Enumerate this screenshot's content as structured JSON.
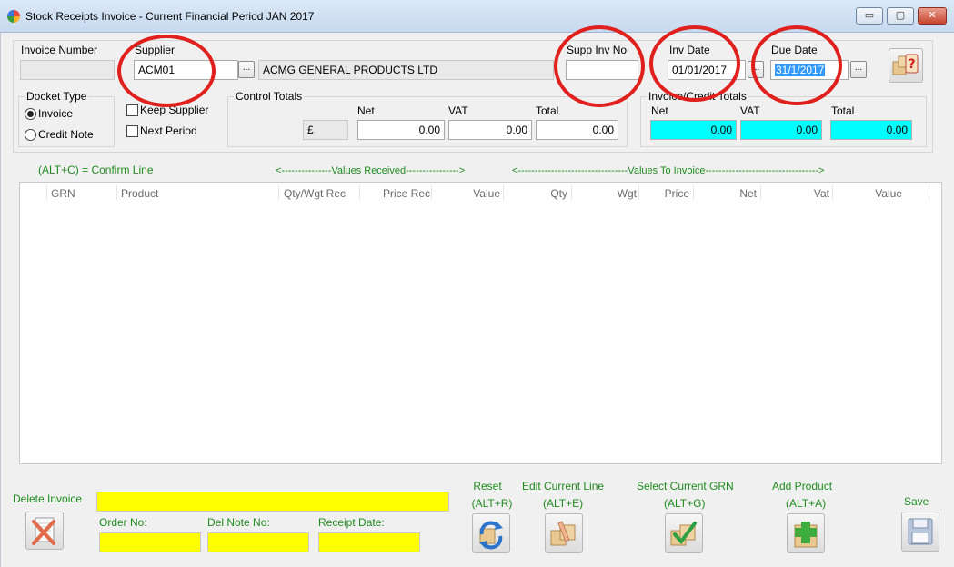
{
  "window": {
    "title": "Stock Receipts Invoice - Current Financial Period JAN 2017",
    "minimize": "▭",
    "maximize": "▢",
    "close": "✕"
  },
  "header": {
    "invoice_number_label": "Invoice Number",
    "invoice_number_value": "",
    "supplier_label": "Supplier",
    "supplier_code": "ACM01",
    "supplier_name": "ACMG GENERAL PRODUCTS LTD",
    "supp_inv_no_label": "Supp Inv No",
    "supp_inv_no_value": "",
    "inv_date_label": "Inv Date",
    "inv_date_value": "01/01/2017",
    "due_date_label": "Due Date",
    "due_date_value": "31/1/2017",
    "ellipsis": "..."
  },
  "docket_type": {
    "label": "Docket Type",
    "options": [
      "Invoice",
      "Credit Note"
    ],
    "selected": "Invoice"
  },
  "options": {
    "keep_supplier": "Keep Supplier",
    "next_period": "Next Period"
  },
  "control_totals": {
    "label": "Control Totals",
    "currency": "£",
    "net_label": "Net",
    "vat_label": "VAT",
    "total_label": "Total",
    "net": "0.00",
    "vat": "0.00",
    "total": "0.00"
  },
  "invoice_totals": {
    "label": "Invoice/Credit Totals",
    "net_label": "Net",
    "vat_label": "VAT",
    "total_label": "Total",
    "net": "0.00",
    "vat": "0.00",
    "total": "0.00"
  },
  "hints": {
    "confirm_line": "(ALT+C) = Confirm Line",
    "values_received": "<---------------Values Received---------------->",
    "values_to_invoice": "<---------------------------------Values To Invoice---------------------------------->"
  },
  "grid": {
    "columns": [
      "GRN",
      "Product",
      "Qty/Wgt Rec",
      "Price Rec",
      "Value",
      "Qty",
      "Wgt",
      "Price",
      "Net",
      "Vat",
      "Value"
    ]
  },
  "footer": {
    "delete_invoice": "Delete Invoice",
    "order_no_label": "Order No:",
    "del_note_no_label": "Del Note No:",
    "receipt_date_label": "Receipt Date:",
    "order_no_value": "",
    "del_note_no_value": "",
    "receipt_date_value": "",
    "notes_value": "",
    "reset_label": "Reset",
    "reset_shortcut": "(ALT+R)",
    "edit_line_label": "Edit Current Line",
    "edit_line_shortcut": "(ALT+E)",
    "select_grn_label": "Select Current GRN",
    "select_grn_shortcut": "(ALT+G)",
    "add_product_label": "Add Product",
    "add_product_shortcut": "(ALT+A)",
    "save_label": "Save"
  },
  "colors": {
    "green_text": "#1e8c1e",
    "cyan_field": "#00ffff",
    "yellow_field": "#ffff00",
    "annotation_red": "#e0201c"
  }
}
